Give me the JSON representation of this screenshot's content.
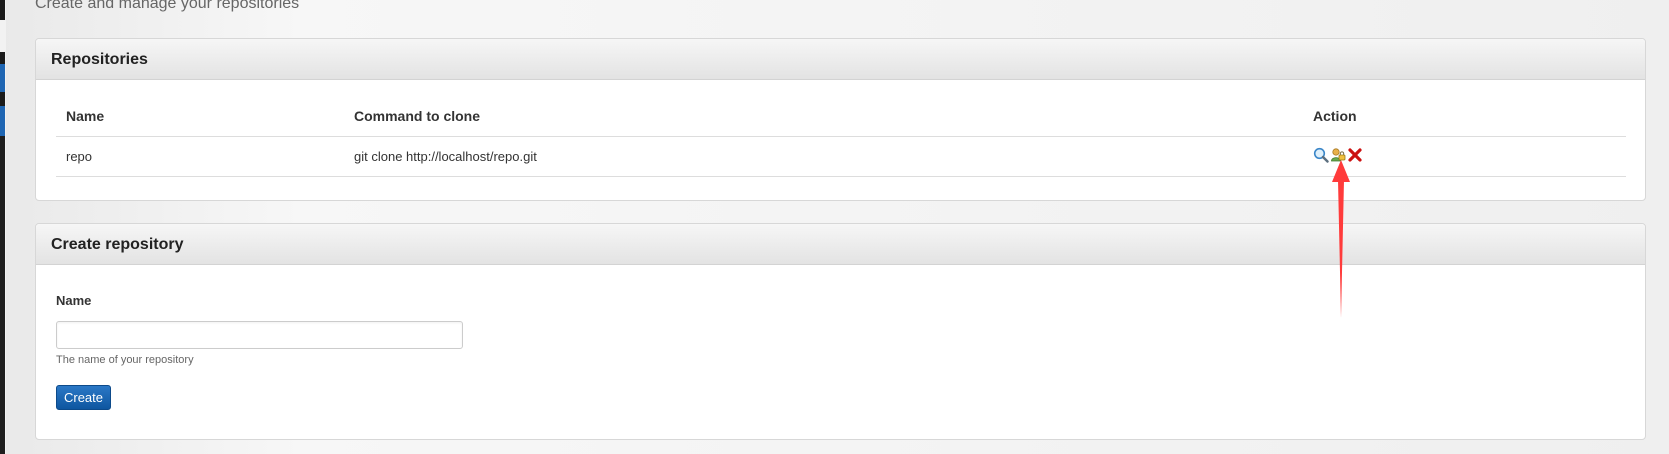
{
  "page": {
    "subtitle": "Create and manage your repositories"
  },
  "repositories": {
    "title": "Repositories",
    "columns": {
      "name": "Name",
      "command": "Command to clone",
      "action": "Action"
    },
    "rows": [
      {
        "name": "repo",
        "command": "git clone http://localhost/repo.git",
        "actions": [
          "view-icon",
          "permissions-icon",
          "delete-icon"
        ]
      }
    ]
  },
  "create": {
    "title": "Create repository",
    "name_label": "Name",
    "name_value": "",
    "name_placeholder": "",
    "help": "The name of your repository",
    "button": "Create"
  },
  "colors": {
    "accent": "#1a64b0",
    "annotation": "#ff3b3b",
    "delete": "#cc1111"
  }
}
